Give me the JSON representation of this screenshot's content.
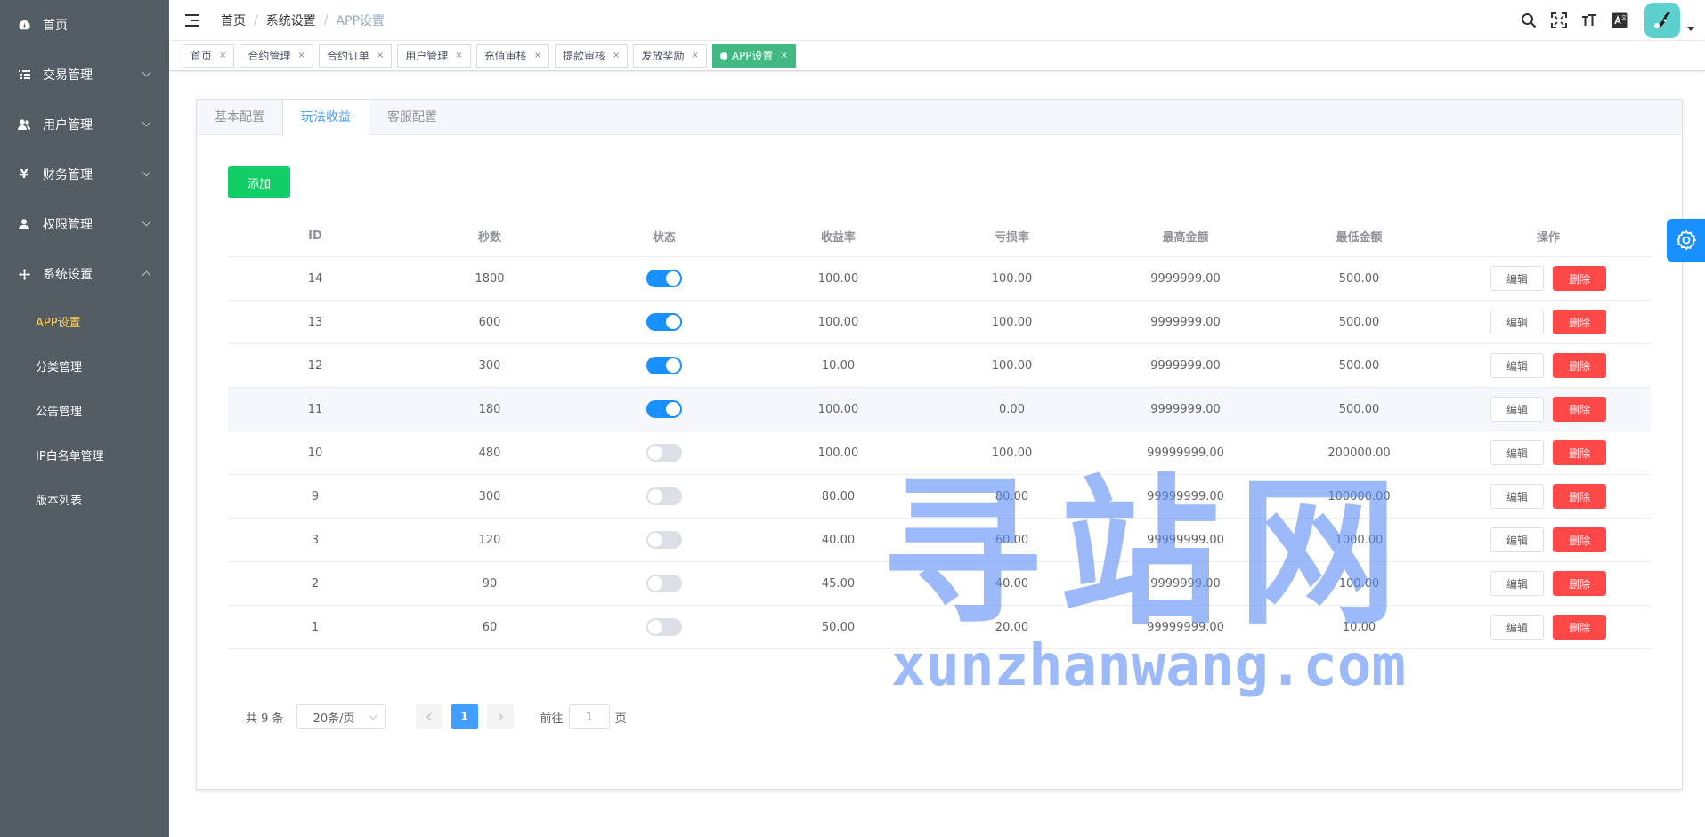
{
  "sidebar": {
    "items": [
      {
        "label": "首页",
        "icon": "dashboard-icon"
      },
      {
        "label": "交易管理",
        "icon": "list-icon"
      },
      {
        "label": "用户管理",
        "icon": "users-icon"
      },
      {
        "label": "财务管理",
        "icon": "yen-icon"
      },
      {
        "label": "权限管理",
        "icon": "user-icon"
      },
      {
        "label": "系统设置",
        "icon": "move-icon"
      }
    ],
    "sub_items": [
      {
        "label": "APP设置",
        "active": true
      },
      {
        "label": "分类管理"
      },
      {
        "label": "公告管理"
      },
      {
        "label": "IP白名单管理"
      },
      {
        "label": "版本列表"
      }
    ]
  },
  "header": {
    "breadcrumb": [
      "首页",
      "系统设置",
      "APP设置"
    ],
    "icons": [
      "search-icon",
      "fullscreen-icon",
      "font-size-icon",
      "translate-icon"
    ]
  },
  "tags": [
    {
      "label": "首页"
    },
    {
      "label": "合约管理"
    },
    {
      "label": "合约订单"
    },
    {
      "label": "用户管理"
    },
    {
      "label": "充值审核"
    },
    {
      "label": "提款审核"
    },
    {
      "label": "发放奖励"
    },
    {
      "label": "APP设置",
      "active": true
    }
  ],
  "card": {
    "tabs": [
      "基本配置",
      "玩法收益",
      "客服配置"
    ],
    "active_tab": 1,
    "add_label": "添加"
  },
  "table": {
    "columns": [
      "ID",
      "秒数",
      "状态",
      "收益率",
      "亏损率",
      "最高金额",
      "最低金额",
      "操作"
    ],
    "edit_label": "编辑",
    "delete_label": "删除",
    "rows": [
      {
        "id": "14",
        "seconds": "1800",
        "status": true,
        "profit": "100.00",
        "loss": "100.00",
        "max": "9999999.00",
        "min": "500.00"
      },
      {
        "id": "13",
        "seconds": "600",
        "status": true,
        "profit": "100.00",
        "loss": "100.00",
        "max": "9999999.00",
        "min": "500.00"
      },
      {
        "id": "12",
        "seconds": "300",
        "status": true,
        "profit": "10.00",
        "loss": "100.00",
        "max": "9999999.00",
        "min": "500.00"
      },
      {
        "id": "11",
        "seconds": "180",
        "status": true,
        "profit": "100.00",
        "loss": "0.00",
        "max": "9999999.00",
        "min": "500.00"
      },
      {
        "id": "10",
        "seconds": "480",
        "status": false,
        "profit": "100.00",
        "loss": "100.00",
        "max": "99999999.00",
        "min": "200000.00"
      },
      {
        "id": "9",
        "seconds": "300",
        "status": false,
        "profit": "80.00",
        "loss": "80.00",
        "max": "99999999.00",
        "min": "100000.00"
      },
      {
        "id": "3",
        "seconds": "120",
        "status": false,
        "profit": "40.00",
        "loss": "60.00",
        "max": "99999999.00",
        "min": "1000.00"
      },
      {
        "id": "2",
        "seconds": "90",
        "status": false,
        "profit": "45.00",
        "loss": "40.00",
        "max": "9999999.00",
        "min": "100.00"
      },
      {
        "id": "1",
        "seconds": "60",
        "status": false,
        "profit": "50.00",
        "loss": "20.00",
        "max": "99999999.00",
        "min": "10.00"
      }
    ]
  },
  "pagination": {
    "total_text": "共 9 条",
    "page_size": "20条/页",
    "current_page": "1",
    "goto_prefix": "前往",
    "goto_value": "1",
    "goto_suffix": "页"
  },
  "watermark": {
    "cn": "寻站网",
    "en": "xunzhanwang.com"
  },
  "colors": {
    "sidebar_bg": "#545c64",
    "active_sub": "#ffd04b",
    "primary": "#409eff",
    "success": "#13ce66",
    "danger": "#ff4949",
    "tag_active": "#42b983",
    "switch_on": "#1890ff"
  }
}
